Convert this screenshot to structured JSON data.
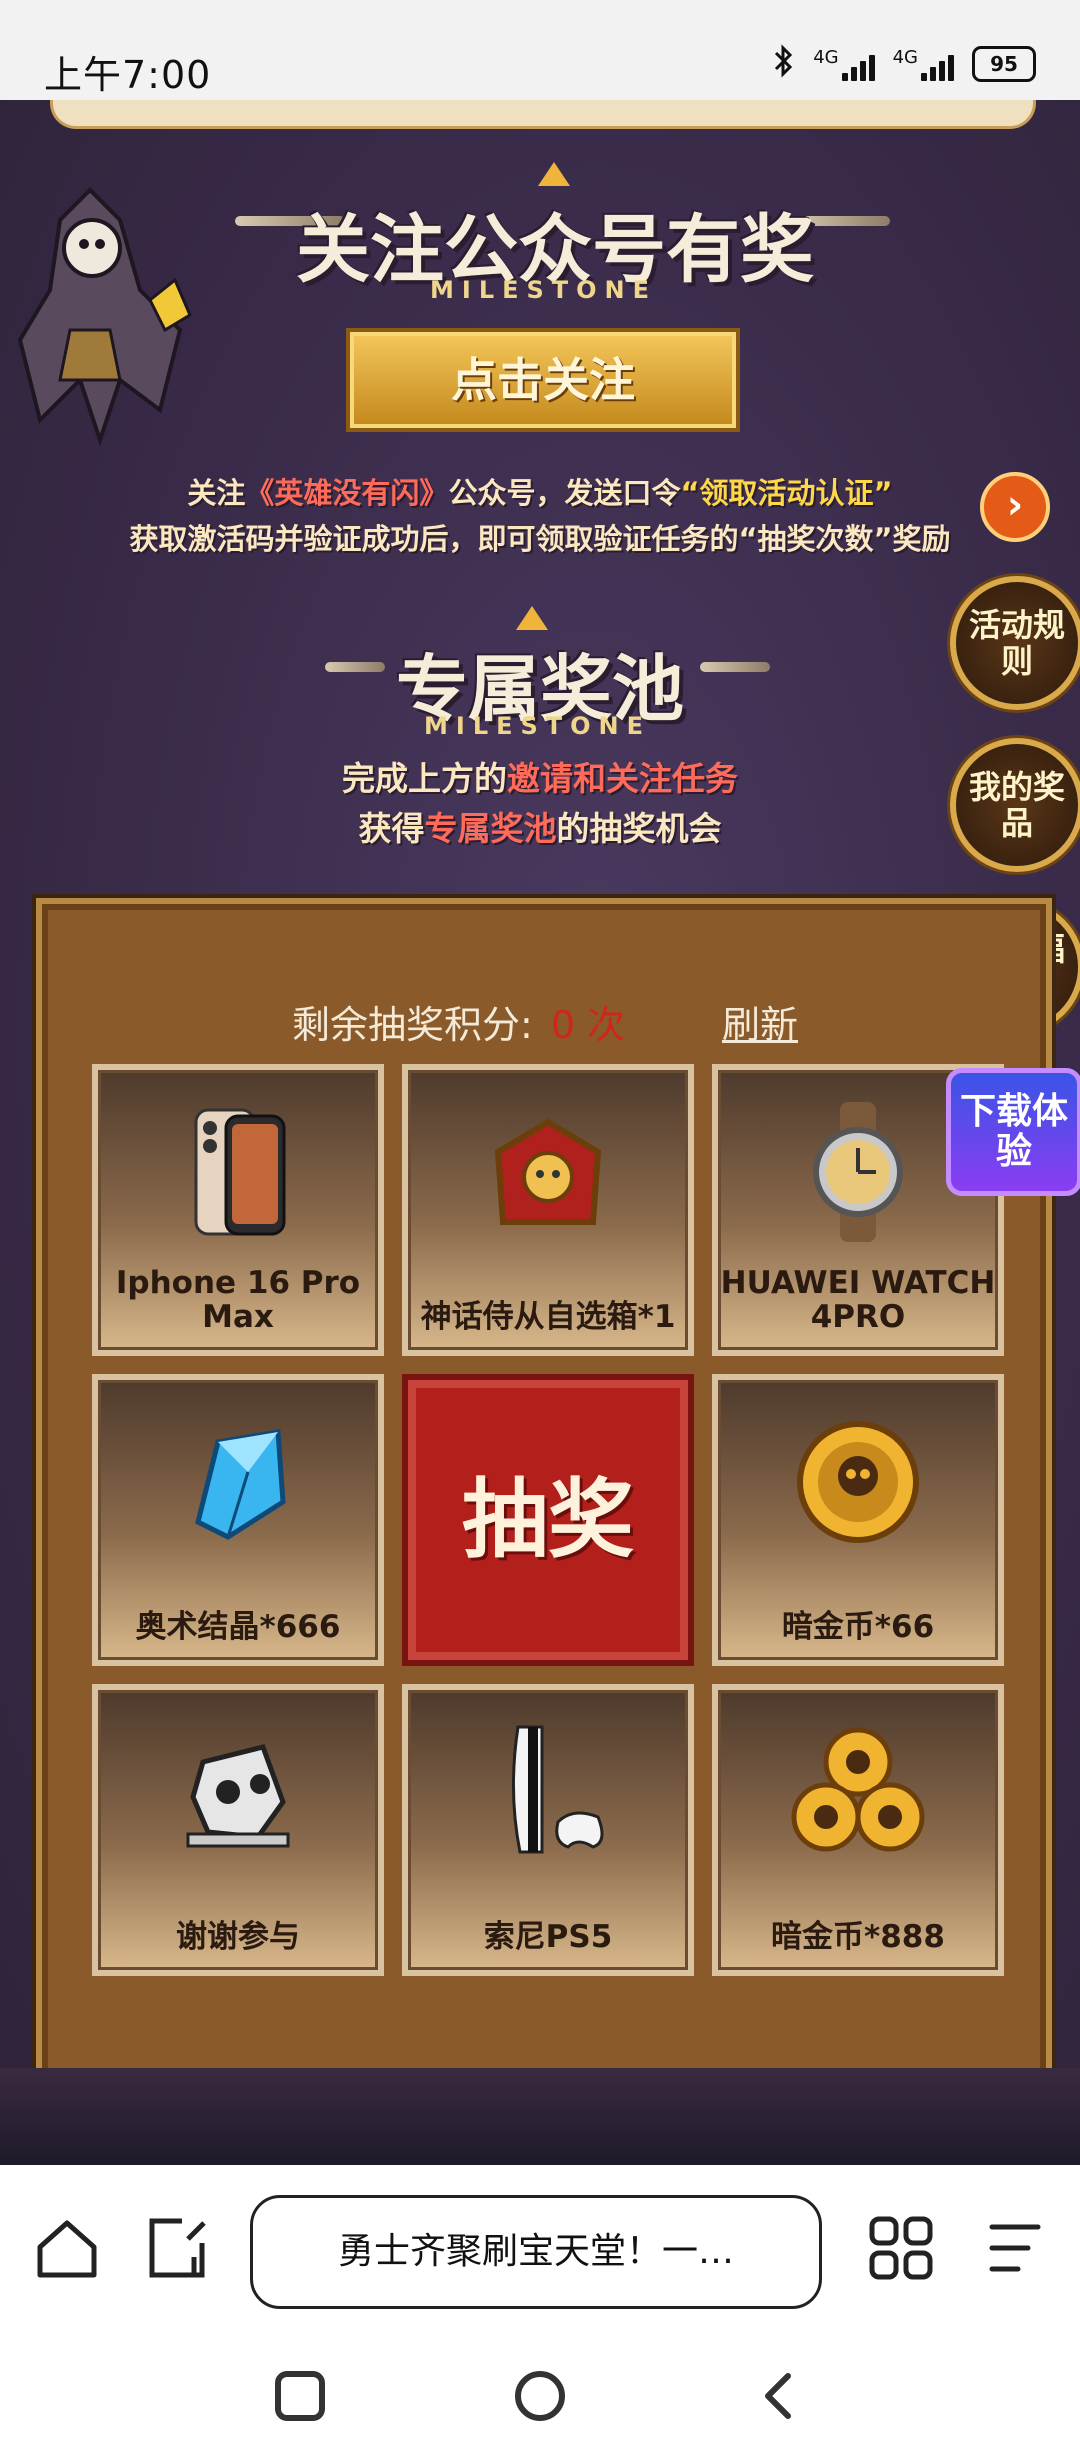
{
  "status_bar": {
    "time": "上午7:00",
    "network1": "4G",
    "network2": "4G",
    "battery": "95"
  },
  "follow_section": {
    "title": "关注公众号有奖",
    "milestone": "MILESTONE",
    "follow_button": "点击关注",
    "instruction": {
      "line1_prefix": "关注",
      "line1_account": "《英雄没有闪》",
      "line1_mid": "公众号，发送口令",
      "line1_code": "“领取活动认证”",
      "line2": "获取激活码并验证成功后，即可领取验证任务的“抽奖次数”奖励"
    }
  },
  "side_buttons": {
    "rules": "活动规则",
    "my_prizes": "我的奖品",
    "exclusive": "专属福利",
    "download": "下载体验"
  },
  "pool_section": {
    "title": "专属奖池",
    "milestone": "MILESTONE",
    "sub_line1_prefix": "完成上方的",
    "sub_line1_hl": "邀请和关注任务",
    "sub_line2_prefix": "获得",
    "sub_line2_hl": "专属奖池",
    "sub_line2_suffix": "的抽奖机会"
  },
  "lottery": {
    "points_label": "剩余抽奖积分:",
    "points_value": "0",
    "points_unit": "次",
    "refresh": "刷新",
    "draw_button": "抽奖",
    "prizes": [
      {
        "label": "Iphone 16 Pro Max",
        "icon": "phone-icon"
      },
      {
        "label": "神话侍从自选箱*1",
        "icon": "chest-icon"
      },
      {
        "label": "HUAWEI WATCH 4PRO",
        "icon": "watch-icon"
      },
      {
        "label": "奥术结晶*666",
        "icon": "crystal-icon"
      },
      {
        "label": "暗金币*66",
        "icon": "coin-icon"
      },
      {
        "label": "谢谢参与",
        "icon": "skull-icon"
      },
      {
        "label": "索尼PS5",
        "icon": "console-icon"
      },
      {
        "label": "暗金币*888",
        "icon": "coins-icon"
      }
    ]
  },
  "browser": {
    "address": "勇士齐聚刷宝天堂！一…"
  },
  "colors": {
    "accent_red": "#d0261a",
    "gold": "#f0b43a",
    "board_brown": "#8a5a2b"
  }
}
